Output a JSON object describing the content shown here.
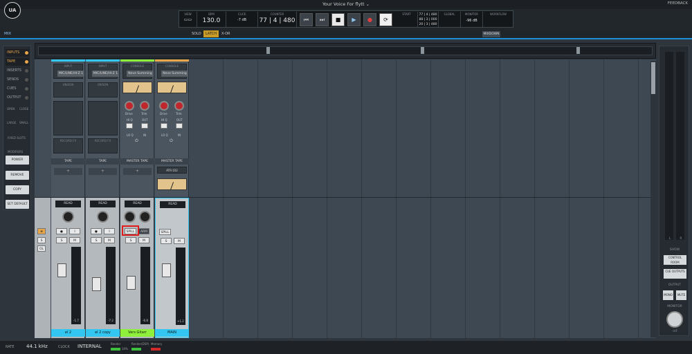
{
  "window": {
    "title": "Your Voice For flytt ⌄",
    "feedback": "FEEDBACK",
    "logo": "UA"
  },
  "transport": {
    "view_label": "VIEW",
    "bpm_label": "BPM",
    "bpm": "130.0",
    "click_label": "CLICK",
    "click_value": "-7 dB",
    "counter_label": "COUNTER",
    "counter": "77 | 4 | 480",
    "start_label": "START",
    "start": "77 | 4 | 480",
    "end": "88 | 3 | 000",
    "len": "20 | 3 | 480",
    "global_label": "GLOBAL",
    "monitor_label": "MONITOR",
    "monitor_value": "-96 dB",
    "workflow_label": "WORKFLOW"
  },
  "mixbar": {
    "mix": "MIX",
    "solo": "SOLO",
    "latch": "LATCH",
    "xor": "X-OR",
    "mixdown": "MIXDOWN"
  },
  "left_nav": [
    {
      "label": "INPUTS",
      "active": true
    },
    {
      "label": "TAPE",
      "active": true
    },
    {
      "label": "INSERTS",
      "active": false
    },
    {
      "label": "SENDS",
      "active": false
    },
    {
      "label": "CUES",
      "active": false
    },
    {
      "label": "OUTPUT",
      "active": false
    }
  ],
  "left_panel": {
    "open": "OPEN",
    "close": "CLOSE",
    "large": "LARGE",
    "small": "SMALL",
    "fixed_slots": "FIXED SLOTS",
    "modifiers": "MODIFIERS",
    "power": "POWER",
    "remove": "REMOVE",
    "copy": "COPY",
    "set_default": "SET DEFAULT"
  },
  "channels": [
    {
      "name": "el 2",
      "input_label": "INPUT",
      "input": "MIC/LINE/HI-Z 1",
      "slot": "UNISON",
      "record": "RECORD FX",
      "tape": "TAPE",
      "read": "READ",
      "name_color": "#33c6f0",
      "fader_val": "-1.7"
    },
    {
      "name": "el 2 copy",
      "input_label": "INPUT",
      "input": "MIC/LINE/HI-Z 1",
      "slot": "UNISON",
      "record": "RECORD FX",
      "tape": "TAPE",
      "read": "READ",
      "name_color": "#33c6f0",
      "fader_val": "-7.2"
    },
    {
      "name": "Vers Gitarr",
      "input_label": "CONSOLE",
      "input": "Neve Summing",
      "tape": "MASTER TAPE",
      "read": "READ",
      "name_color": "#8ef03b",
      "fader_val": "-6.8",
      "spill": "SPILL",
      "arm": "ARM",
      "drive": "Drive",
      "trim": "Trim",
      "hi_q": "HI Q",
      "lo_q": "LO Q",
      "out": "OUT",
      "in": "IN"
    },
    {
      "name": "MAIN",
      "input_label": "CONSOLE",
      "input": "Neve Summing",
      "tape": "MASTER TAPE",
      "tape_insert": "ATR-102",
      "read": "READ",
      "name_color": "#33c6f0",
      "fader_val": "+1.2",
      "spill": "SPILL",
      "drive": "Drive",
      "trim": "Trim",
      "hi_q": "HI Q",
      "lo_q": "LO Q",
      "out": "OUT",
      "in": "IN"
    }
  ],
  "strip_buttons": {
    "s": "S",
    "m": "M",
    "i": "I",
    "ol": "OL"
  },
  "right_panel": {
    "show": "SHOW",
    "control_room": "CONTROL ROOM",
    "cue_outputs": "CUE OUTPUTS",
    "output": "OUTPUT",
    "mono": "MONO",
    "mute": "MUTE",
    "monitor": "MONITOR",
    "monitor_val": "-inF",
    "l": "L",
    "r": "R"
  },
  "status": {
    "rate_label": "RATE",
    "rate": "44.1 kHz",
    "clock_label": "CLOCK",
    "clock": "INTERNAL",
    "render": "Render",
    "render_val": "34%",
    "render_dsp": "Render(DSP)",
    "memory": "Memory"
  }
}
